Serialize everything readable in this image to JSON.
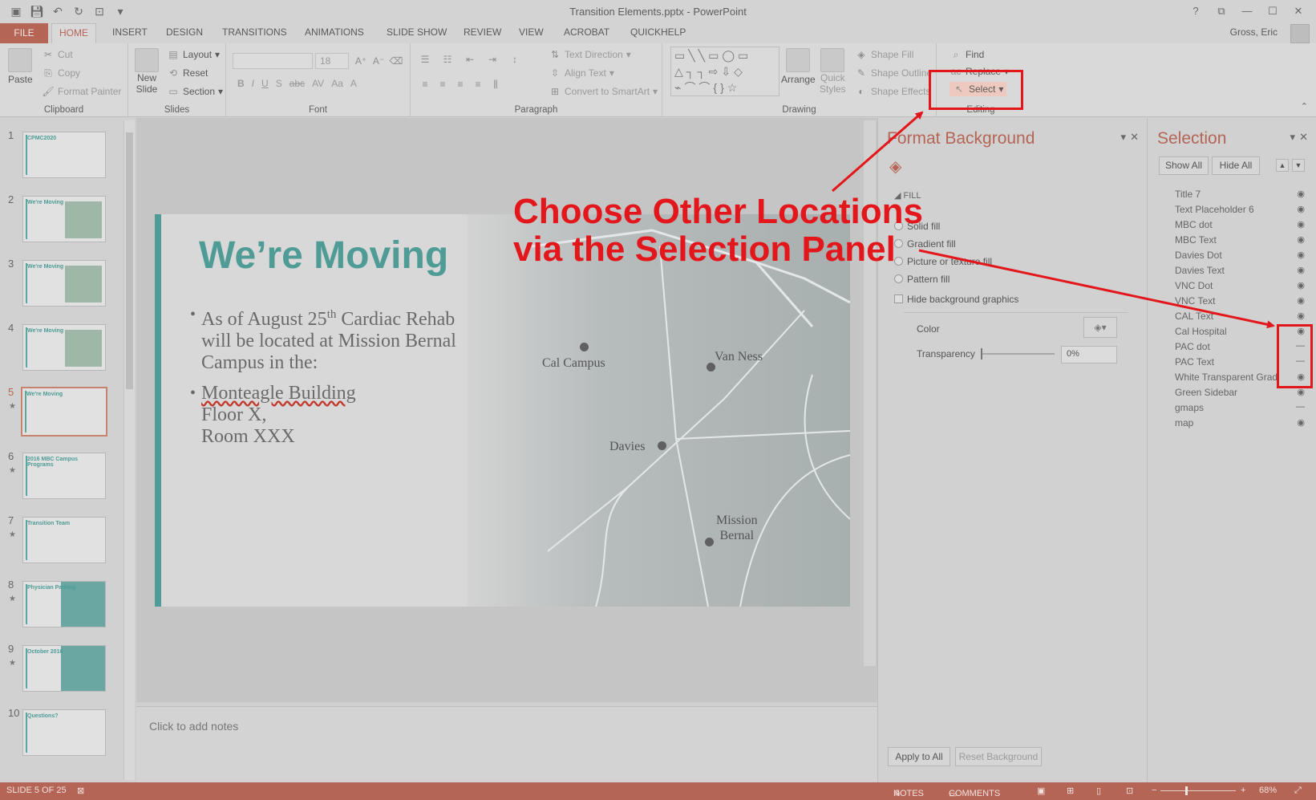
{
  "titlebar": {
    "title": "Transition Elements.pptx - PowerPoint",
    "controls": [
      "?",
      "⧉",
      "—",
      "☐",
      "✕"
    ]
  },
  "tabs": {
    "file": "FILE",
    "items": [
      "HOME",
      "INSERT",
      "DESIGN",
      "TRANSITIONS",
      "ANIMATIONS",
      "SLIDE SHOW",
      "REVIEW",
      "VIEW",
      "ACROBAT",
      "QUICKHELP"
    ],
    "active": "HOME",
    "user": "Gross, Eric"
  },
  "ribbon": {
    "clipboard": {
      "paste": "Paste",
      "cut": "Cut",
      "copy": "Copy",
      "format_painter": "Format Painter",
      "label": "Clipboard"
    },
    "slides": {
      "new_slide_1": "New",
      "new_slide_2": "Slide",
      "layout": "Layout",
      "reset": "Reset",
      "section": "Section",
      "label": "Slides"
    },
    "font": {
      "size": "18",
      "label": "Font",
      "buttons": [
        "B",
        "I",
        "U",
        "S",
        "abc",
        "AV",
        "Aa",
        "A"
      ]
    },
    "paragraph": {
      "text_direction": "Text Direction",
      "align_text": "Align Text",
      "convert_smartart": "Convert to SmartArt",
      "label": "Paragraph"
    },
    "drawing": {
      "arrange": "Arrange",
      "quick_styles_1": "Quick",
      "quick_styles_2": "Styles",
      "shape_fill": "Shape Fill",
      "shape_outline": "Shape Outline",
      "shape_effects": "Shape Effects",
      "label": "Drawing"
    },
    "editing": {
      "find": "Find",
      "replace": "Replace",
      "select": "Select",
      "label": "Editing"
    }
  },
  "thumbnails": [
    {
      "num": "1",
      "title": "CPMC2020",
      "star": false
    },
    {
      "num": "2",
      "title": "We're Moving",
      "star": false
    },
    {
      "num": "3",
      "title": "We're Moving",
      "star": false
    },
    {
      "num": "4",
      "title": "We're Moving",
      "star": false
    },
    {
      "num": "5",
      "title": "We're Moving",
      "star": true
    },
    {
      "num": "6",
      "title": "2016 MBC Campus Programs",
      "star": true
    },
    {
      "num": "7",
      "title": "Transition Team",
      "star": true
    },
    {
      "num": "8",
      "title": "Physician Parking",
      "star": true
    },
    {
      "num": "9",
      "title": "October 2016",
      "star": true
    },
    {
      "num": "10",
      "title": "Questions?",
      "star": false
    }
  ],
  "slide": {
    "title": "We’re Moving",
    "bullet1_a": "As of August 25",
    "bullet1_sup": "th",
    "bullet1_b": " Cardiac Rehab",
    "bullet1_line2": "will be located at Mission Bernal",
    "bullet1_line3": "Campus in the:",
    "bullet2_line1": "Monteagle Building",
    "bullet2_line2": "Floor X,",
    "bullet2_line3": "Room XXX",
    "map_labels": {
      "cal": "Cal Campus",
      "van_ness": "Van Ness",
      "davies": "Davies",
      "mission_1": "Mission",
      "mission_2": "Bernal"
    }
  },
  "notes": {
    "placeholder": "Click to add notes"
  },
  "format_background": {
    "title": "Format Background",
    "section": "FILL",
    "options": [
      "Solid fill",
      "Gradient fill",
      "Picture or texture fill",
      "Pattern fill"
    ],
    "hide_graphics": "Hide background graphics",
    "color_label": "Color",
    "transparency_label": "Transparency",
    "transparency_value": "0%",
    "apply_all": "Apply to All",
    "reset": "Reset Background"
  },
  "selection": {
    "title": "Selection",
    "show_all": "Show All",
    "hide_all": "Hide All",
    "items": [
      {
        "label": "Title 7",
        "visible": true
      },
      {
        "label": "Text Placeholder 6",
        "visible": true
      },
      {
        "label": "MBC dot",
        "visible": true
      },
      {
        "label": "MBC Text",
        "visible": true
      },
      {
        "label": "Davies Dot",
        "visible": true
      },
      {
        "label": "Davies Text",
        "visible": true
      },
      {
        "label": "VNC Dot",
        "visible": true
      },
      {
        "label": "VNC Text",
        "visible": true
      },
      {
        "label": "CAL Text",
        "visible": true
      },
      {
        "label": "Cal Hospital",
        "visible": true
      },
      {
        "label": "PAC dot",
        "visible": false
      },
      {
        "label": "PAC Text",
        "visible": false
      },
      {
        "label": "White Transparent Grad",
        "visible": true
      },
      {
        "label": "Green Sidebar",
        "visible": true
      },
      {
        "label": "gmaps",
        "visible": false
      },
      {
        "label": "map",
        "visible": true
      }
    ]
  },
  "statusbar": {
    "slide": "SLIDE 5 OF 25",
    "notes": "NOTES",
    "comments": "COMMENTS",
    "zoom": "68%"
  },
  "annotation": {
    "line1": "Choose Other Locations",
    "line2": "via the Selection Panel",
    "color": "#e3171b"
  },
  "colors": {
    "accent": "#b56556",
    "teal": "#4f9c96"
  }
}
